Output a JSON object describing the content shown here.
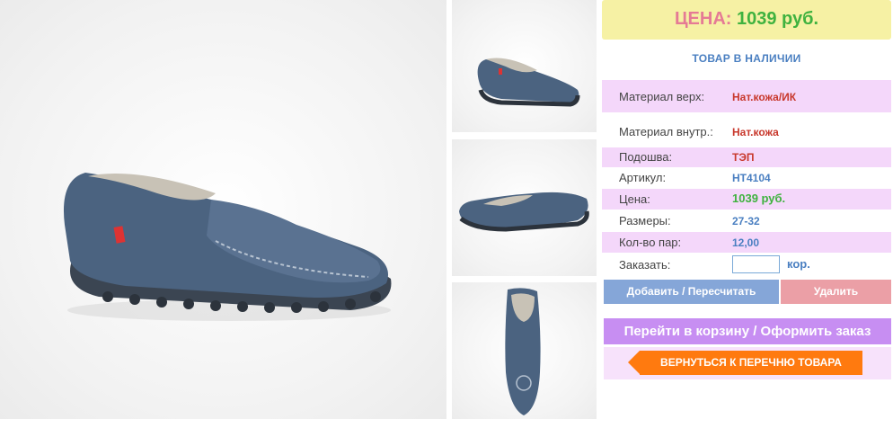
{
  "product": {
    "main_image_icon": "loafer-shoe-side-view",
    "thumbnails": [
      {
        "icon": "loafer-shoe-side-view"
      },
      {
        "icon": "loafer-shoe-inner-view"
      },
      {
        "icon": "loafer-shoe-top-view"
      }
    ]
  },
  "price_banner": {
    "label": "ЦЕНА:",
    "value": "1039 руб."
  },
  "stock_status": "ТОВАР В НАЛИЧИИ",
  "specs": [
    {
      "key": "Материал верх:",
      "value": "Нат.кожа/ИК"
    },
    {
      "key": "Материал внутр.:",
      "value": "Нат.кожа"
    },
    {
      "key": "Подошва:",
      "value": "ТЭП"
    },
    {
      "key": "Артикул:",
      "value": "НТ4104"
    },
    {
      "key": "Цена:",
      "value": "1039 руб."
    },
    {
      "key": "Размеры:",
      "value": "27-32"
    },
    {
      "key": "Кол-во пар:",
      "value": "12,00"
    }
  ],
  "order": {
    "label": "Заказать:",
    "value": "",
    "unit": "кор."
  },
  "buttons": {
    "add": "Добавить / Пересчитать",
    "delete": "Удалить",
    "cart": "Перейти в корзину / Оформить заказ",
    "back": "ВЕРНУТЬСЯ К ПЕРЕЧНЮ ТОВАРА"
  },
  "colors": {
    "banner_bg": "#f6f1a4",
    "price_green": "#3fb23f",
    "label_pink": "#e57a95",
    "accent_blue": "#4a7fc1",
    "value_red": "#c8382c",
    "row_pink": "#f4d7fa",
    "cart_purple": "#c78ef2",
    "back_orange": "#ff7a0f"
  }
}
